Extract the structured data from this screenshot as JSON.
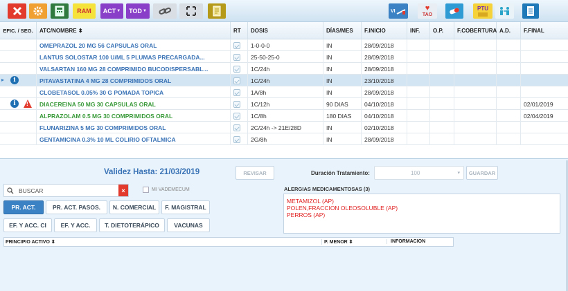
{
  "toolbar": {
    "ram_label": "RAM",
    "act_label": "ACT",
    "tod_label": "TOD",
    "tao_label": "TAO",
    "ptu_label": "PTU",
    "vi_label": "VI"
  },
  "grid": {
    "columns": [
      "EFIC. / SEG.",
      "ATC/NOMBRE ⬍",
      "RT",
      "DOSIS",
      "DÍAS/MES",
      "F.INICIO",
      "INF.",
      "O.P.",
      "F.COBERTURA",
      "A.D.",
      "F.FINAL"
    ],
    "rows": [
      {
        "name": "OMEPRAZOL 20 MG 56 CAPSULAS ORAL",
        "dosis": "1-0-0-0",
        "dias": "IN",
        "inicio": "28/09/2018",
        "final": "",
        "color": "blue",
        "selected": false,
        "info": false,
        "warn": false
      },
      {
        "name": "LANTUS SOLOSTAR 100 U/ML 5 PLUMAS PRECARGADA...",
        "dosis": "25-50-25-0",
        "dias": "IN",
        "inicio": "28/09/2018",
        "final": "",
        "color": "blue",
        "selected": false,
        "info": false,
        "warn": false
      },
      {
        "name": "VALSARTAN 160 MG 28 COMPRIMIDO BUCODISPERSABL...",
        "dosis": "1C/24h",
        "dias": "IN",
        "inicio": "28/09/2018",
        "final": "",
        "color": "blue",
        "selected": false,
        "info": false,
        "warn": false
      },
      {
        "name": "PITAVASTATINA 4 MG 28 COMPRIMIDOS ORAL",
        "dosis": "1C/24h",
        "dias": "IN",
        "inicio": "23/10/2018",
        "final": "",
        "color": "blue",
        "selected": true,
        "info": true,
        "warn": false
      },
      {
        "name": "CLOBETASOL 0.05% 30 G POMADA TOPICA",
        "dosis": "1A/8h",
        "dias": "IN",
        "inicio": "28/09/2018",
        "final": "",
        "color": "blue",
        "selected": false,
        "info": false,
        "warn": false
      },
      {
        "name": "DIACEREINA 50 MG 30 CAPSULAS ORAL",
        "dosis": "1C/12h",
        "dias": "90 DIAS",
        "inicio": "04/10/2018",
        "final": "02/01/2019",
        "color": "green",
        "selected": false,
        "info": true,
        "warn": true
      },
      {
        "name": "ALPRAZOLAM 0.5 MG 30 COMPRIMIDOS ORAL",
        "dosis": "1C/8h",
        "dias": "180 DIAS",
        "inicio": "04/10/2018",
        "final": "02/04/2019",
        "color": "green",
        "selected": false,
        "info": false,
        "warn": false
      },
      {
        "name": "FLUNARIZINA 5 MG 30 COMPRIMIDOS ORAL",
        "dosis": "2C/24h -> 21E/28D",
        "dias": "IN",
        "inicio": "02/10/2018",
        "final": "",
        "color": "blue",
        "selected": false,
        "info": false,
        "warn": false
      },
      {
        "name": "GENTAMICINA 0.3% 10 ML COLIRIO OFTALMICA",
        "dosis": "2G/8h",
        "dias": "IN",
        "inicio": "28/09/2018",
        "final": "",
        "color": "blue",
        "selected": false,
        "info": false,
        "warn": false
      }
    ]
  },
  "validity": {
    "label": "Validez Hasta:  21/03/2019",
    "revisar": "REVISAR",
    "duration_label": "Duración Tratamiento:",
    "duration_value": "100",
    "guardar": "GUARDAR"
  },
  "search": {
    "placeholder": "BUSCAR",
    "vademecum": "MI VADEMECUM"
  },
  "filters": {
    "row1": [
      "PR. ACT.",
      "PR. ACT. PASOS.",
      "N. COMERCIAL",
      "F. MAGISTRAL"
    ],
    "row2": [
      "EF. Y ACC. CI",
      "EF. Y ACC.",
      "T. DIETOTERÁPICO",
      "VACUNAS"
    ]
  },
  "allergies": {
    "title": "ALERGIAS MEDICAMENTOSAS (3)",
    "items": [
      "METAMIZOL (AP)",
      "POLEN,FRACCION OLEOSOLUBLE (AP)",
      "PERROS (AP)"
    ]
  },
  "results": {
    "col1": "PRINCIPIO ACTIVO ⬍",
    "col2": "P. MENOR ⬍",
    "col3": "INFORMACION"
  },
  "colors": {
    "accent": "#3b82c4",
    "blue_text": "#3a73b6",
    "green_text": "#3a9a3a",
    "allergy_red": "#e02020"
  }
}
